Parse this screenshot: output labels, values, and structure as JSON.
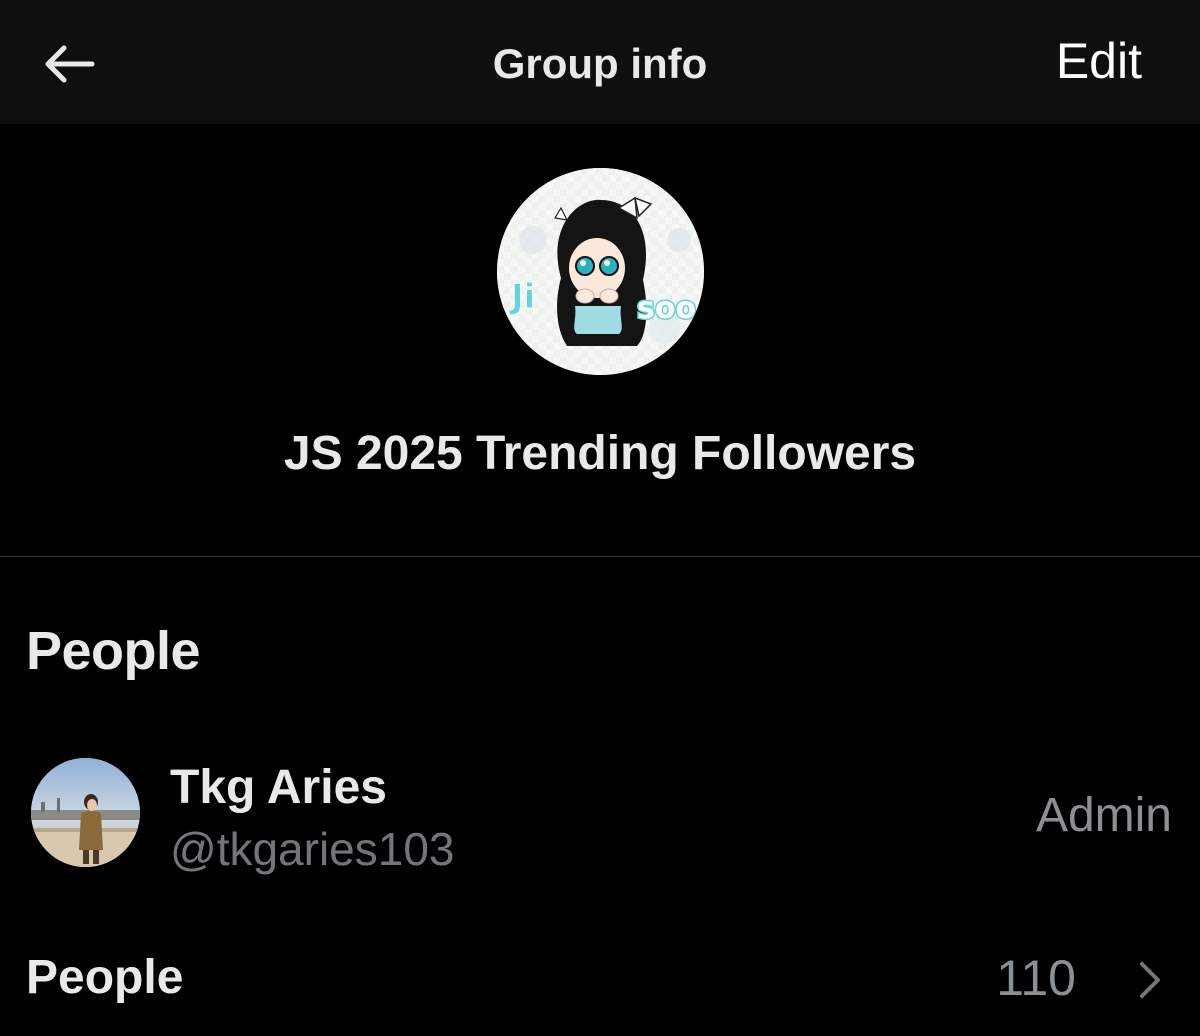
{
  "header": {
    "back_icon": "arrow-left-icon",
    "title": "Group info",
    "edit_label": "Edit"
  },
  "group": {
    "avatar_text_left": "Ji",
    "avatar_text_right": "soo",
    "name": "JS 2025 Trending Followers"
  },
  "people_section": {
    "heading": "People",
    "members": [
      {
        "name": "Tkg Aries",
        "handle": "@tkgaries103",
        "role": "Admin"
      }
    ],
    "summary": {
      "label": "People",
      "count": "110",
      "icon": "chevron-right-icon"
    }
  },
  "colors": {
    "background": "#000000",
    "header_background": "#0f0f0f",
    "primary_text": "#e7e9ea",
    "secondary_text": "#71767b",
    "divider": "#2f3336",
    "avatar_accent": "#5fd3d9"
  }
}
